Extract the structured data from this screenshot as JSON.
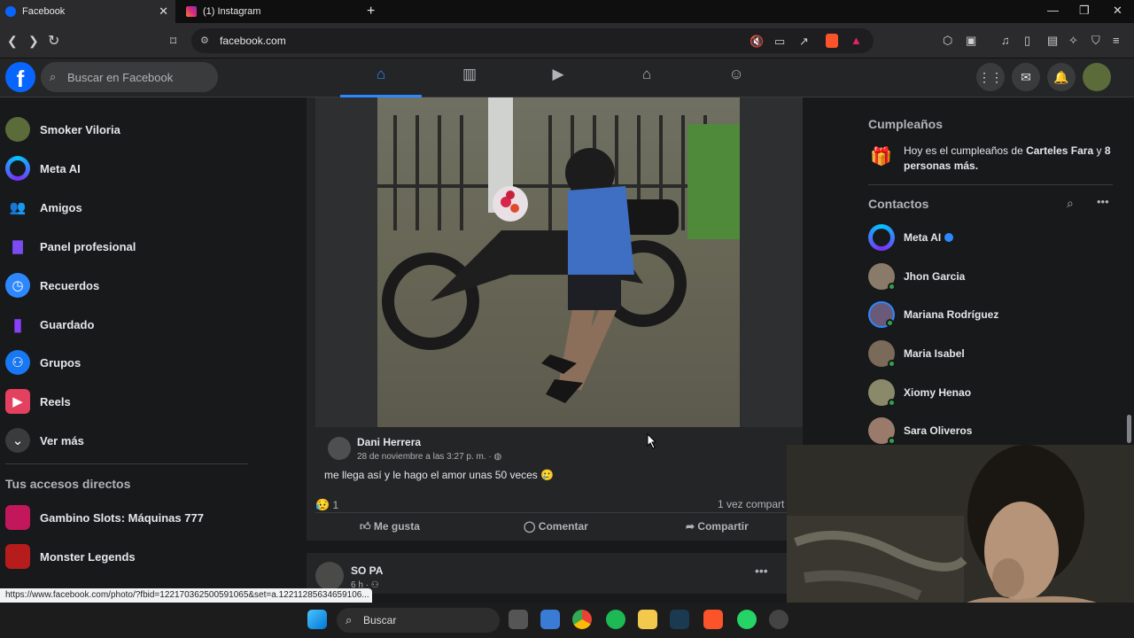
{
  "browser": {
    "tabs": [
      {
        "label": "Facebook",
        "active": true
      },
      {
        "label": "(1) Instagram",
        "active": false
      }
    ],
    "url": "facebook.com",
    "status_url": "https://www.facebook.com/photo/?fbid=122170362500591065&set=a.12211285634659106..."
  },
  "fb": {
    "search_placeholder": "Buscar en Facebook",
    "nav_tabs": [
      "home-icon",
      "dashboard-icon",
      "video-icon",
      "marketplace-icon",
      "groups-icon"
    ]
  },
  "sidebar": {
    "items": [
      {
        "label": "Smoker Viloria",
        "icon": "profile-avatar",
        "color": "#5c6b3a"
      },
      {
        "label": "Meta AI",
        "icon": "meta-ai-icon",
        "color": "#3b5bdb"
      },
      {
        "label": "Amigos",
        "icon": "friends-icon",
        "color": "#1877f2"
      },
      {
        "label": "Panel profesional",
        "icon": "chart-icon",
        "color": "#7a4cf2"
      },
      {
        "label": "Recuerdos",
        "icon": "clock-icon",
        "color": "#2d88ff"
      },
      {
        "label": "Guardado",
        "icon": "bookmark-icon",
        "color": "#8a3ffc"
      },
      {
        "label": "Grupos",
        "icon": "groups-icon",
        "color": "#1877f2"
      },
      {
        "label": "Reels",
        "icon": "reels-icon",
        "color": "#e4405f"
      },
      {
        "label": "Ver más",
        "icon": "chevron-down-icon",
        "color": "#3a3b3c"
      }
    ],
    "shortcuts_title": "Tus accesos directos",
    "shortcuts": [
      {
        "label": "Gambino Slots: Máquinas 777",
        "color": "#c2185b"
      },
      {
        "label": "Monster Legends",
        "color": "#b71c1c"
      }
    ]
  },
  "post": {
    "author": "Dani Herrera",
    "meta": "28 de noviembre a las 3:27 p. m. ·",
    "caption": "me llega así y le hago el amor unas 50 veces 🥲",
    "reactions_count": "1",
    "shares": "1 vez compart",
    "actions": {
      "like": "Me gusta",
      "comment": "Comentar",
      "share": "Compartir"
    }
  },
  "post2": {
    "author": "SO PA",
    "meta": "6 h ·"
  },
  "right": {
    "birthdays_title": "Cumpleaños",
    "birthday_text_prefix": "Hoy es el cumpleaños de",
    "birthday_name": "Carteles Fara",
    "birthday_text_and": "y",
    "birthday_text_rest": "8 personas más.",
    "contacts_title": "Contactos",
    "contacts": [
      {
        "name": "Meta AI",
        "color": "#3b5bdb",
        "online": false,
        "verified": true
      },
      {
        "name": "Jhon Garcia",
        "color": "#8a7a6a",
        "online": true
      },
      {
        "name": "Mariana Rodríguez",
        "color": "#6a5a7a",
        "online": true
      },
      {
        "name": "Maria Isabel",
        "color": "#7a6a5a",
        "online": true
      },
      {
        "name": "Xiomy Henao",
        "color": "#8a8a6a",
        "online": true
      },
      {
        "name": "Sara Oliveros",
        "color": "#9a7a6a",
        "online": true
      }
    ]
  },
  "taskbar": {
    "search": "Buscar"
  },
  "colors": {
    "fb_blue": "#0866ff",
    "accent": "#2d88ff",
    "online": "#31a24c"
  }
}
